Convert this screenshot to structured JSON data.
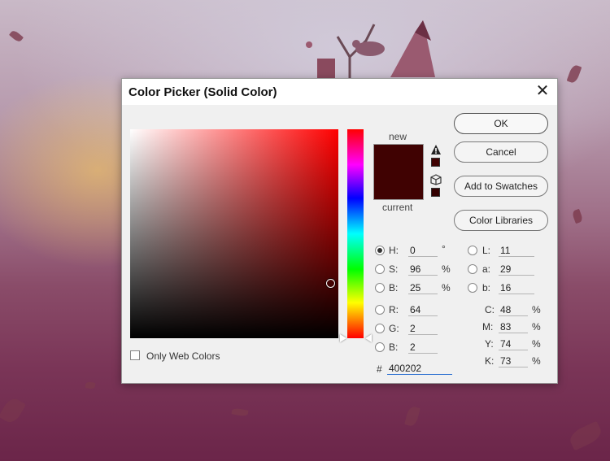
{
  "dialog": {
    "title": "Color Picker (Solid Color)",
    "close_label": "✕"
  },
  "swatches": {
    "new_label": "new",
    "current_label": "current",
    "new_color": "#400202",
    "current_color": "#400202"
  },
  "buttons": {
    "ok": "OK",
    "cancel": "Cancel",
    "add_to_swatches": "Add to Swatches",
    "color_libraries": "Color Libraries"
  },
  "hsb": {
    "h_label": "H:",
    "h_value": "0",
    "h_unit": "°",
    "s_label": "S:",
    "s_value": "96",
    "s_unit": "%",
    "b_label": "B:",
    "b_value": "25",
    "b_unit": "%"
  },
  "rgb": {
    "r_label": "R:",
    "r_value": "64",
    "g_label": "G:",
    "g_value": "2",
    "b_label": "B:",
    "b_value": "2"
  },
  "lab": {
    "l_label": "L:",
    "l_value": "11",
    "a_label": "a:",
    "a_value": "29",
    "b_label": "b:",
    "b_value": "16"
  },
  "cmyk": {
    "c_label": "C:",
    "c_value": "48",
    "c_unit": "%",
    "m_label": "M:",
    "m_value": "83",
    "m_unit": "%",
    "y_label": "Y:",
    "y_value": "74",
    "y_unit": "%",
    "k_label": "K:",
    "k_value": "73",
    "k_unit": "%"
  },
  "hex": {
    "label": "#",
    "value": "400202"
  },
  "options": {
    "only_web_colors": "Only Web Colors"
  }
}
